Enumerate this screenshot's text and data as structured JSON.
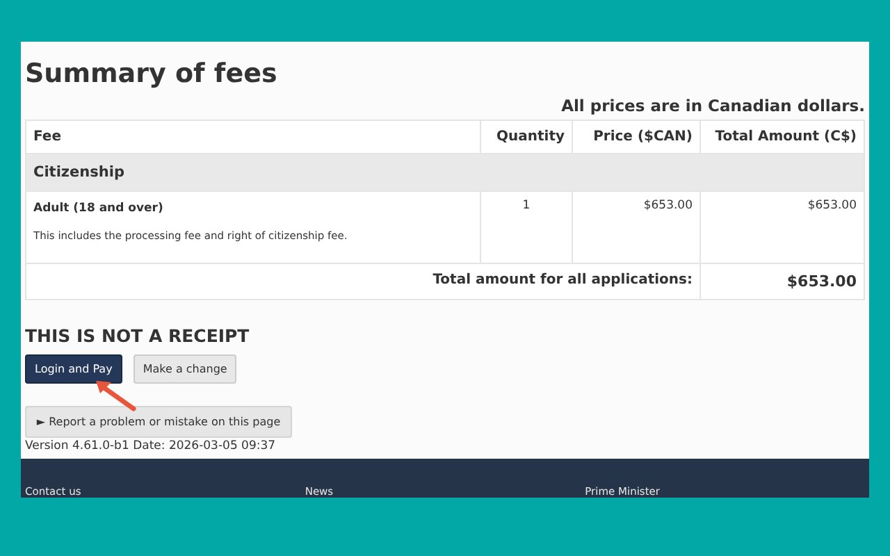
{
  "title": "Summary of fees",
  "currency_note": "All prices are in Canadian dollars.",
  "table": {
    "columns": [
      "Fee",
      "Quantity",
      "Price ($CAN)",
      "Total Amount (C$)"
    ],
    "group": "Citizenship",
    "rows": [
      {
        "name": "Adult (18 and over)",
        "description": "This includes the processing fee and right of citizenship fee.",
        "quantity": "1",
        "price": "$653.00",
        "total": "$653.00"
      }
    ],
    "total_label": "Total amount for all applications:",
    "total_value": "$653.00"
  },
  "notice": "THIS IS NOT A RECEIPT",
  "buttons": [
    {
      "label": "Login and Pay",
      "kind": "primary"
    },
    {
      "label": "Make a change",
      "kind": "secondary"
    }
  ],
  "report_button": "► Report a problem or mistake on this page",
  "version": "Version 4.61.0-b1 Date: 2026-03-05 09:37",
  "footer_links": [
    "Contact us",
    "News",
    "Prime Minister"
  ]
}
